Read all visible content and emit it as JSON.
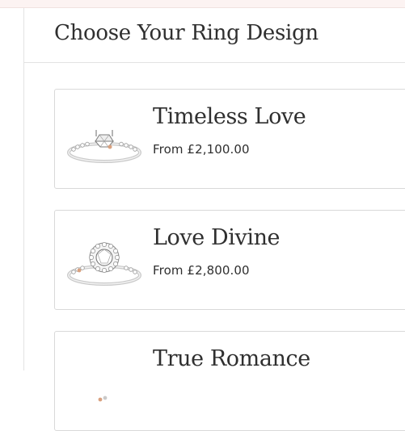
{
  "page": {
    "title": "Choose Your Ring Design"
  },
  "colors": {
    "top_strip": "#fcf3f2",
    "border": "#d9d9d9",
    "text": "#2f2f2f",
    "rose_gold_accent": "#d9a17f"
  },
  "rings": [
    {
      "name": "Timeless Love",
      "price": "From £2,100.00",
      "image_icon": "solitaire-ring-icon"
    },
    {
      "name": "Love Divine",
      "price": "From £2,800.00",
      "image_icon": "halo-ring-icon"
    },
    {
      "name": "True Romance",
      "price": "",
      "image_icon": "ring-icon"
    }
  ]
}
